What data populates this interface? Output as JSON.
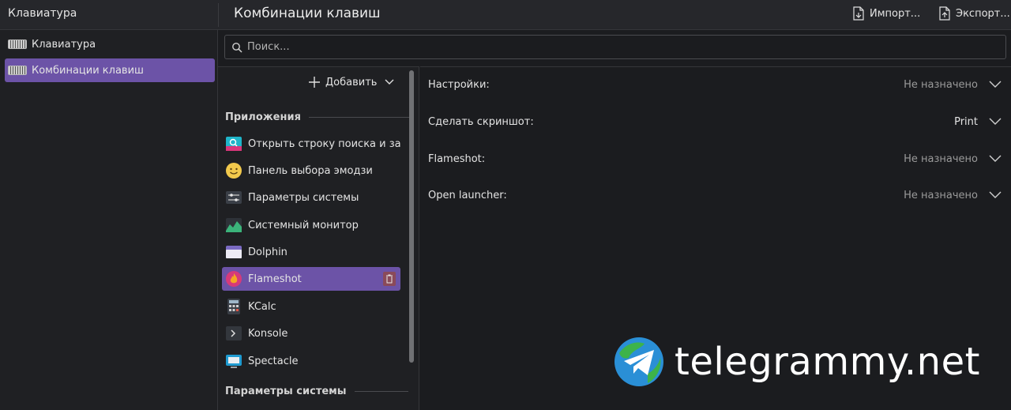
{
  "header": {
    "left_title": "Клавиатура",
    "page_title": "Комбинации клавиш",
    "import_label": "Импорт...",
    "export_label": "Экспорт..."
  },
  "sidebar": {
    "items": [
      {
        "label": "Клавиатура",
        "icon": "keyboard-icon",
        "active": false
      },
      {
        "label": "Комбинации клавиш",
        "icon": "keyboard-icon",
        "active": true
      }
    ]
  },
  "search": {
    "placeholder": "Поиск..."
  },
  "components": {
    "add_label": "Добавить",
    "sections": [
      {
        "title": "Приложения",
        "items": [
          {
            "label": "Открыть строку поиска и за...",
            "icon": "krunner-icon"
          },
          {
            "label": "Панель выбора эмодзи",
            "icon": "emoji-icon"
          },
          {
            "label": "Параметры системы",
            "icon": "system-settings-icon"
          },
          {
            "label": "Системный монитор",
            "icon": "system-monitor-icon"
          },
          {
            "label": "Dolphin",
            "icon": "dolphin-icon"
          },
          {
            "label": "Flameshot",
            "icon": "flameshot-icon",
            "active": true
          },
          {
            "label": "KCalc",
            "icon": "kcalc-icon"
          },
          {
            "label": "Konsole",
            "icon": "konsole-icon"
          },
          {
            "label": "Spectacle",
            "icon": "spectacle-icon"
          }
        ]
      },
      {
        "title": "Параметры системы",
        "items": []
      }
    ]
  },
  "shortcuts": [
    {
      "label": "Настройки:",
      "value": "Не назначено",
      "assigned": false
    },
    {
      "label": "Сделать скриншот:",
      "value": "Print",
      "assigned": true
    },
    {
      "label": "Flameshot:",
      "value": "Не назначено",
      "assigned": false
    },
    {
      "label": "Open launcher:",
      "value": "Не назначено",
      "assigned": false
    }
  ],
  "watermark": {
    "text": "telegrammy.net",
    "icon": "telegram-globe-icon"
  },
  "colors": {
    "accent": "#6c53a7",
    "background": "#1b1c1f",
    "panel": "#1f2023"
  }
}
